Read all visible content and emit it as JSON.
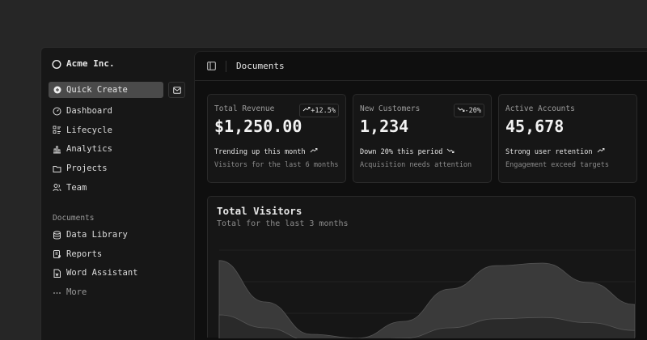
{
  "sidebar": {
    "brand": "Acme Inc.",
    "quick_create": "Quick Create",
    "items": [
      {
        "label": "Dashboard",
        "icon": "dashboard-icon"
      },
      {
        "label": "Lifecycle",
        "icon": "list-details-icon"
      },
      {
        "label": "Analytics",
        "icon": "chart-bar-icon"
      },
      {
        "label": "Projects",
        "icon": "folder-icon"
      },
      {
        "label": "Team",
        "icon": "users-icon"
      }
    ],
    "section_title": "Documents",
    "docs": [
      {
        "label": "Data Library",
        "icon": "database-icon"
      },
      {
        "label": "Reports",
        "icon": "report-icon"
      },
      {
        "label": "Word Assistant",
        "icon": "file-word-icon"
      },
      {
        "label": "More",
        "icon": "dots-icon"
      }
    ]
  },
  "header": {
    "title": "Documents"
  },
  "cards": [
    {
      "label": "Total Revenue",
      "value": "$1,250.00",
      "badge": "+12.5%",
      "trend": "up",
      "line1": "Trending up this month",
      "line2": "Visitors for the last 6 months"
    },
    {
      "label": "New Customers",
      "value": "1,234",
      "badge": "-20%",
      "trend": "down",
      "line1": "Down 20% this period",
      "line2": "Acquisition needs attention"
    },
    {
      "label": "Active Accounts",
      "value": "45,678",
      "badge": "",
      "trend": "up",
      "line1": "Strong user retention",
      "line2": "Engagement exceed targets"
    }
  ],
  "chart_data": {
    "type": "area",
    "title": "Total Visitors",
    "subtitle": "Total for the last 3 months",
    "grid": true,
    "series": [
      {
        "values": [
          62,
          30,
          5,
          2,
          15,
          40,
          58,
          60,
          45,
          28
        ]
      },
      {
        "values": [
          20,
          10,
          0,
          0,
          2,
          10,
          17,
          18,
          14,
          8
        ]
      }
    ],
    "colors": [
      "#3a3a3a",
      "#2a2a2a"
    ]
  }
}
